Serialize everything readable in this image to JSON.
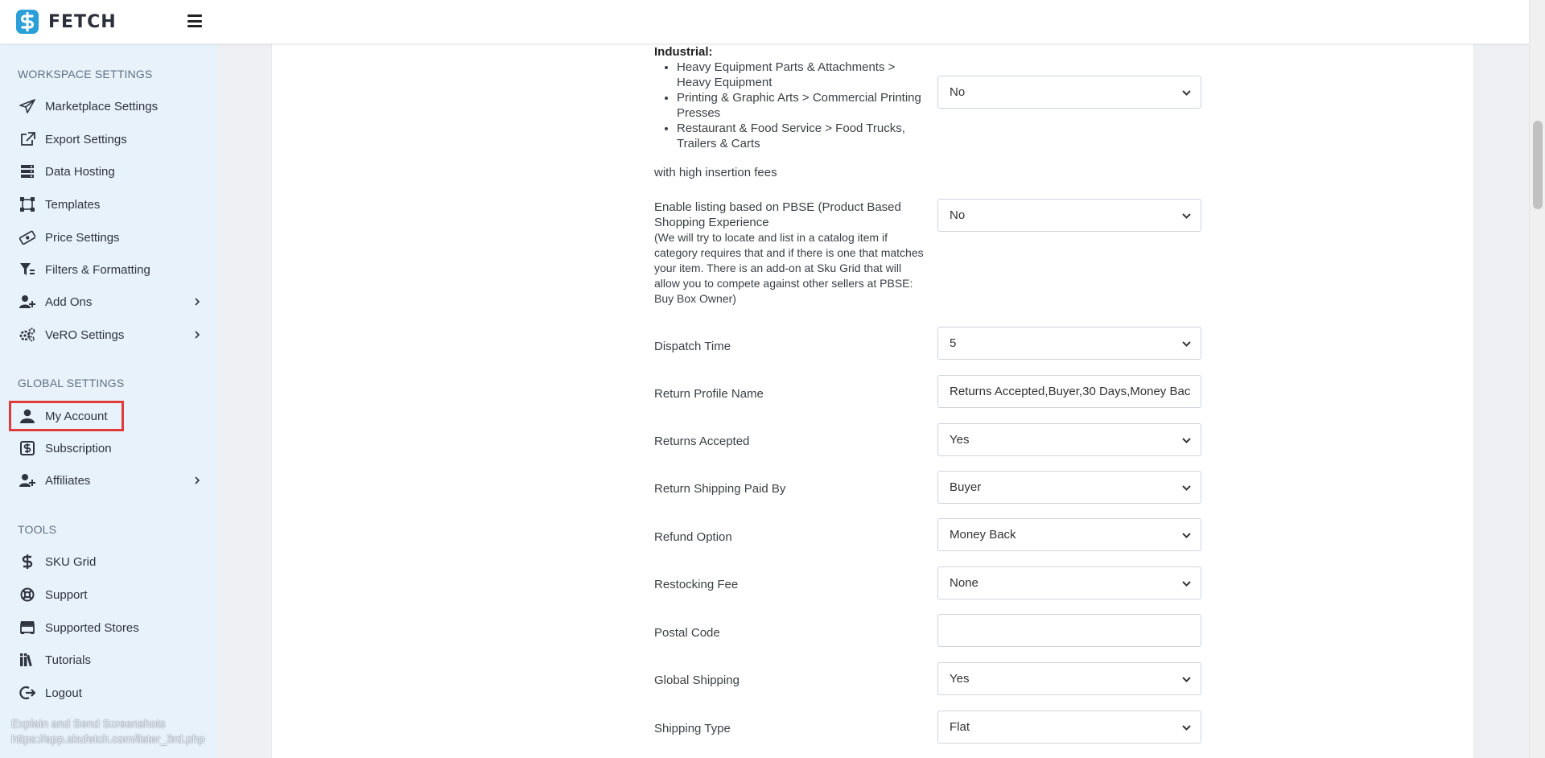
{
  "app": {
    "brand": "FETCH",
    "brand_color": "#2a9fd8"
  },
  "sidebar": {
    "sections": [
      {
        "title": "WORKSPACE SETTINGS"
      },
      {
        "title": "GLOBAL SETTINGS"
      },
      {
        "title": "TOOLS"
      }
    ],
    "items": [
      {
        "label": "Marketplace Settings",
        "icon": "paper-plane-icon"
      },
      {
        "label": "Export Settings",
        "icon": "external-link-icon"
      },
      {
        "label": "Data Hosting",
        "icon": "server-icon"
      },
      {
        "label": "Templates",
        "icon": "vector-square-icon"
      },
      {
        "label": "Price Settings",
        "icon": "money-bill-icon"
      },
      {
        "label": "Filters & Formatting",
        "icon": "filter-icon"
      },
      {
        "label": "Add Ons",
        "icon": "user-plus-icon",
        "chevron": true
      },
      {
        "label": "VeRO Settings",
        "icon": "cogs-icon",
        "chevron": true
      },
      {
        "label": "My Account",
        "icon": "user-icon",
        "highlighted": true,
        "highlight_color": "#e03b3b"
      },
      {
        "label": "Subscription",
        "icon": "dollar-box-icon"
      },
      {
        "label": "Affiliates",
        "icon": "user-plus-icon",
        "chevron": true
      },
      {
        "label": "SKU Grid",
        "icon": "dollar-icon"
      },
      {
        "label": "Support",
        "icon": "life-ring-icon"
      },
      {
        "label": "Supported Stores",
        "icon": "store-icon"
      },
      {
        "label": "Tutorials",
        "icon": "books-icon"
      },
      {
        "label": "Logout",
        "icon": "sign-out-icon"
      }
    ],
    "footer": {
      "line1": "Explain and Send Screenshots",
      "line2": "https://app.skufetch.com/lister_3rd.php"
    }
  },
  "form": {
    "industrial": {
      "heading": "Industrial:",
      "bullets": [
        "Heavy Equipment Parts & Attachments > Heavy Equipment",
        "Printing & Graphic Arts > Commercial Printing Presses",
        "Restaurant & Food Service > Food Trucks, Trailers & Carts"
      ],
      "tail": "with high insertion fees",
      "value": "No"
    },
    "pbse": {
      "label": "Enable listing based on PBSE (Product Based Shopping Experience",
      "note": "(We will try to locate and list in a catalog item if category requires that and if there is one that matches your item. There is an add-on at Sku Grid that will allow you to compete against other sellers at PBSE: Buy Box Owner)",
      "value": "No"
    },
    "fields": [
      {
        "label": "Dispatch Time",
        "value": "5",
        "type": "select"
      },
      {
        "label": "Return Profile Name",
        "value": "Returns Accepted,Buyer,30 Days,Money Bac",
        "type": "input"
      },
      {
        "label": "Returns Accepted",
        "value": "Yes",
        "type": "select"
      },
      {
        "label": "Return Shipping Paid By",
        "value": "Buyer",
        "type": "select"
      },
      {
        "label": "Refund Option",
        "value": "Money Back",
        "type": "select"
      },
      {
        "label": "Restocking Fee",
        "value": "None",
        "type": "select"
      },
      {
        "label": "Postal Code",
        "value": "",
        "type": "input"
      },
      {
        "label": "Global Shipping",
        "value": "Yes",
        "type": "select"
      },
      {
        "label": "Shipping Type",
        "value": "Flat",
        "type": "select"
      }
    ]
  }
}
